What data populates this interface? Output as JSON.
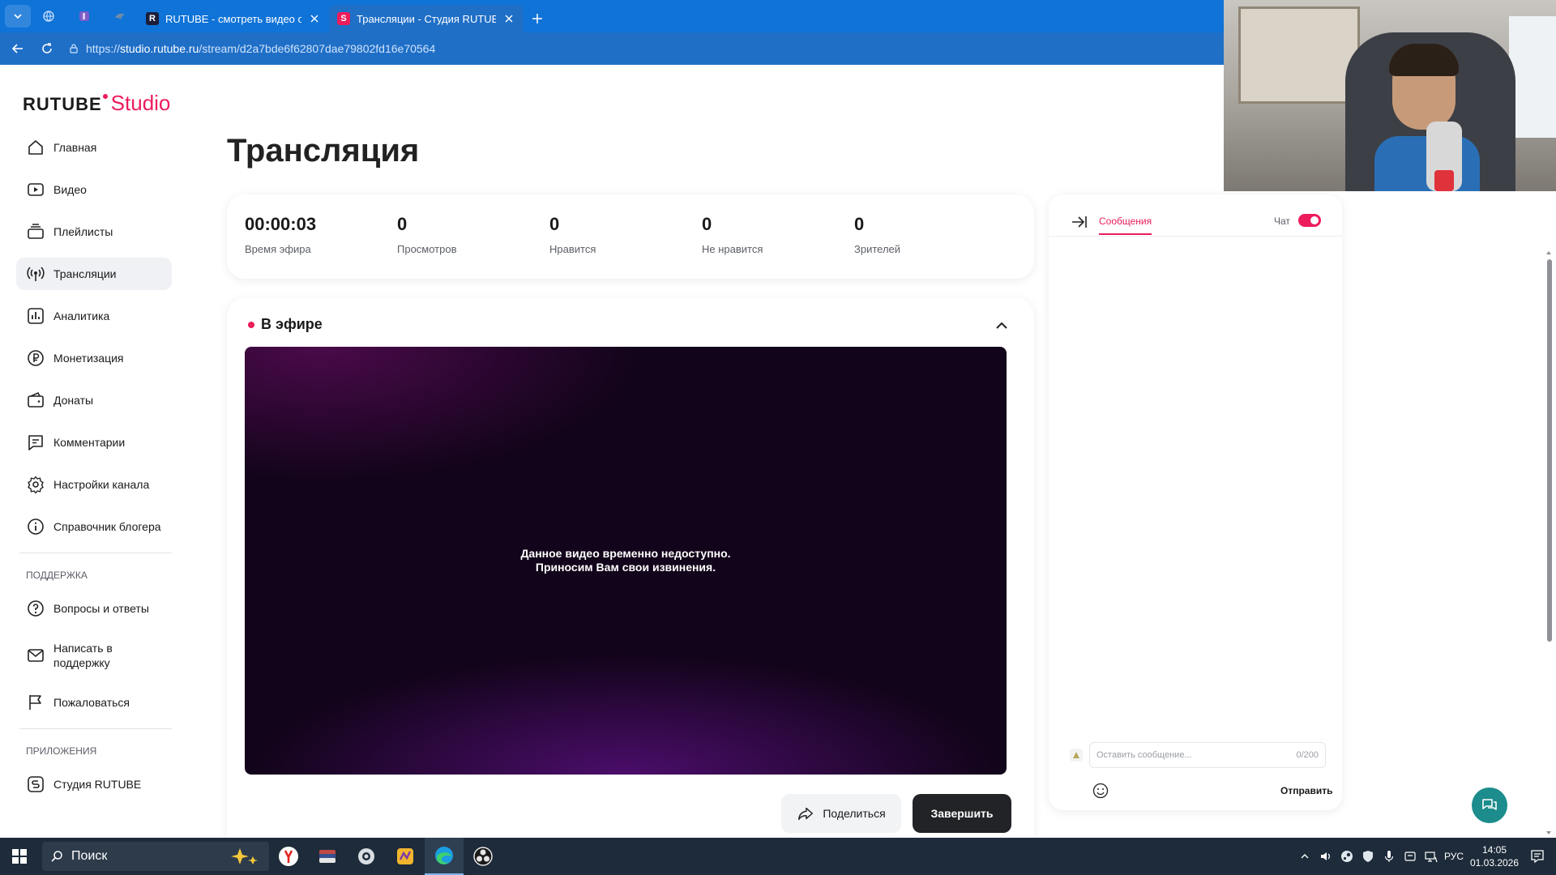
{
  "browser": {
    "tabs": [
      {
        "title": "RUTUBE - смотреть видео онлайн",
        "active": false
      },
      {
        "title": "Трансляции - Студия RUTUBE",
        "active": true
      }
    ],
    "url_prefix": "https://",
    "url_host": "studio.rutube.ru",
    "url_path": "/stream/d2a7bde6f62807dae79802fd16e70564"
  },
  "app": {
    "logo_main": "RUTUBE",
    "logo_sub": "Studio",
    "brand_color": "#ed1c5b"
  },
  "sidebar": {
    "items": [
      {
        "label": "Главная",
        "icon": "home-icon"
      },
      {
        "label": "Видео",
        "icon": "video-icon"
      },
      {
        "label": "Плейлисты",
        "icon": "playlist-icon"
      },
      {
        "label": "Трансляции",
        "icon": "broadcast-icon",
        "active": true
      },
      {
        "label": "Аналитика",
        "icon": "analytics-icon"
      },
      {
        "label": "Монетизация",
        "icon": "ruble-icon"
      },
      {
        "label": "Донаты",
        "icon": "wallet-icon"
      },
      {
        "label": "Комментарии",
        "icon": "comment-icon"
      },
      {
        "label": "Настройки канала",
        "icon": "gear-icon"
      },
      {
        "label": "Справочник блогера",
        "icon": "info-icon"
      }
    ],
    "support_title": "ПОДДЕРЖКА",
    "support_items": [
      {
        "label": "Вопросы и ответы",
        "icon": "question-icon"
      },
      {
        "label": "Написать в поддержку",
        "icon": "mail-icon"
      },
      {
        "label": "Пожаловаться",
        "icon": "flag-icon"
      }
    ],
    "apps_title": "ПРИЛОЖЕНИЯ",
    "apps_items": [
      {
        "label": "Студия RUTUBE",
        "icon": "studio-icon"
      }
    ]
  },
  "main": {
    "title": "Трансляция",
    "stats": [
      {
        "value": "00:00:03",
        "label": "Время эфира"
      },
      {
        "value": "0",
        "label": "Просмотров"
      },
      {
        "value": "0",
        "label": "Нравится"
      },
      {
        "value": "0",
        "label": "Не нравится"
      },
      {
        "value": "0",
        "label": "Зрителей"
      }
    ],
    "live_label": "В эфире",
    "player_msg_line1": "Данное видео временно недоступно.",
    "player_msg_line2": "Приносим Вам свои извинения.",
    "share_label": "Поделиться",
    "end_label": "Завершить"
  },
  "chat": {
    "tab_label": "Сообщения",
    "toggle_label": "Чат",
    "toggle_on": true,
    "input_placeholder": "Оставить сообщение...",
    "char_count": "0/200",
    "send_label": "Отправить"
  },
  "taskbar": {
    "search_placeholder": "Поиск",
    "lang": "РУС",
    "time": "14:05",
    "date": "01.03.2026"
  }
}
